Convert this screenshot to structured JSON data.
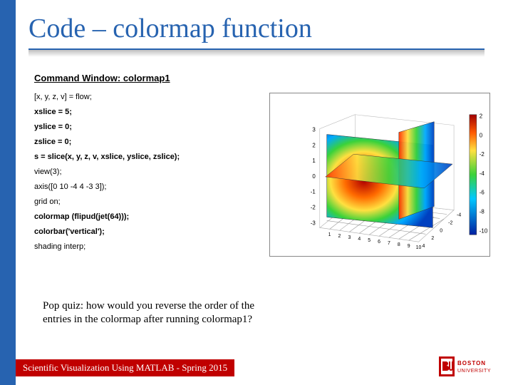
{
  "title": "Code – colormap function",
  "command_header": "Command Window: colormap1",
  "code_lines": [
    {
      "text": "[x, y, z, v] = flow;",
      "bold": false
    },
    {
      "text": "xslice = 5;",
      "bold": true
    },
    {
      "text": "yslice = 0;",
      "bold": true
    },
    {
      "text": "zslice = 0;",
      "bold": true
    },
    {
      "text": "s = slice(x, y, z, v, xslice, yslice, zslice);",
      "bold": true
    },
    {
      "text": "view(3);",
      "bold": false
    },
    {
      "text": "axis([0 10 -4 4 -3 3]);",
      "bold": false
    },
    {
      "text": "grid on;",
      "bold": false
    },
    {
      "text": "colormap (flipud(jet(64)));",
      "bold": true
    },
    {
      "text": "colorbar('vertical');",
      "bold": true
    },
    {
      "text": "shading interp;",
      "bold": false
    }
  ],
  "plot": {
    "z_ticks": [
      "3",
      "2",
      "1",
      "0",
      "-1",
      "-2",
      "-3"
    ],
    "x_ticks": [
      "1",
      "2",
      "3",
      "4",
      "5",
      "6",
      "7",
      "8",
      "9",
      "10"
    ],
    "y_ticks": [
      "4",
      "2",
      "0",
      "-2",
      "-4"
    ],
    "colorbar_ticks": [
      "2",
      "0",
      "-2",
      "-4",
      "-6",
      "-8",
      "-10"
    ]
  },
  "quiz": "Pop quiz: how would you reverse the order of the entries in the colormap after running colormap1?",
  "footer": "Scientific Visualization Using MATLAB - Spring 2015",
  "logo": {
    "top": "BOSTON",
    "bottom": "UNIVERSITY"
  }
}
